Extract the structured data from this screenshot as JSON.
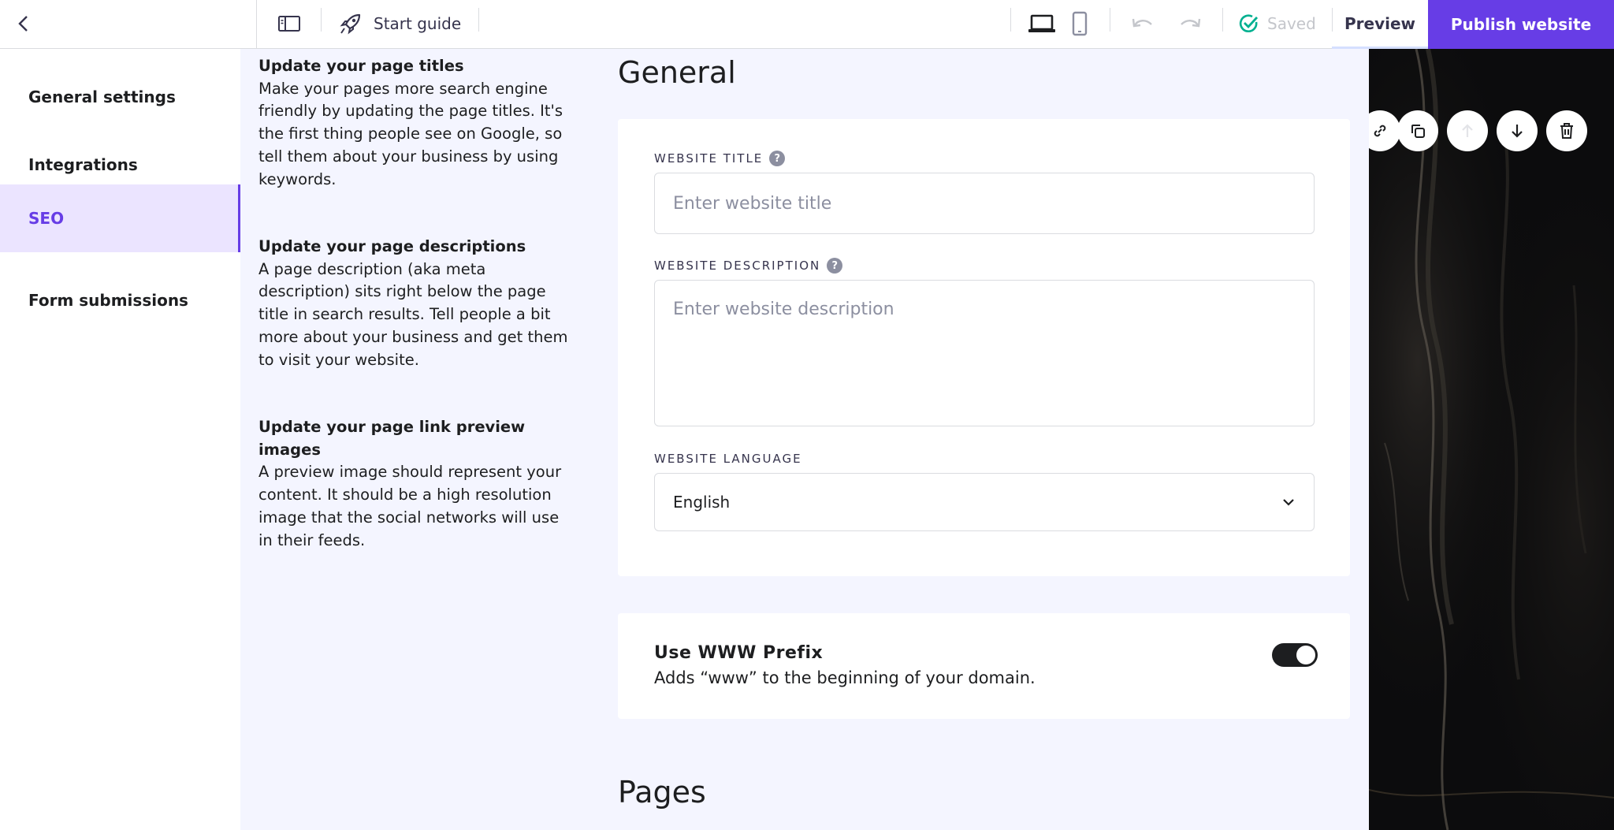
{
  "topbar": {
    "start_guide_label": "Start guide",
    "saved_label": "Saved",
    "preview_label": "Preview",
    "publish_label": "Publish website"
  },
  "sidenav": {
    "items": [
      {
        "label": "General settings",
        "active": false
      },
      {
        "label": "Integrations",
        "active": false
      },
      {
        "label": "SEO",
        "active": true
      },
      {
        "label": "Form submissions",
        "active": false
      }
    ]
  },
  "help": [
    {
      "title": "Update your page titles",
      "body": "Make your pages more search engine friendly by updating the page titles. It's the first thing people see on Google, so tell them about your business by using keywords."
    },
    {
      "title": "Update your page descriptions",
      "body": "A page description (aka meta description) sits right below the page title in search results. Tell people a bit more about your business and get them to visit your website."
    },
    {
      "title": "Update your page link preview images",
      "body": "A preview image should represent your content. It should be a high resolution image that the social networks will use in their feeds."
    }
  ],
  "general": {
    "title": "General",
    "website_title_label": "WEBSITE TITLE",
    "website_title_placeholder": "Enter website title",
    "website_title_value": "",
    "website_description_label": "WEBSITE DESCRIPTION",
    "website_description_placeholder": "Enter website description",
    "website_description_value": "",
    "website_language_label": "WEBSITE LANGUAGE",
    "website_language_value": "English"
  },
  "www_prefix": {
    "title": "Use WWW Prefix",
    "description": "Adds “www” to the beginning of your domain.",
    "enabled": true
  },
  "pages": {
    "title": "Pages"
  },
  "colors": {
    "accent": "#673de6",
    "active_nav_bg": "#ebe4ff",
    "saved_check": "#00b090",
    "main_bg": "#f4f5ff"
  },
  "icons": {
    "back": "chevron-left-icon",
    "sidebar": "sidebar-panel-icon",
    "start_guide": "rocket-icon",
    "desktop": "laptop-icon",
    "mobile": "mobile-icon",
    "undo": "undo-icon",
    "redo": "redo-icon",
    "saved": "check-circle-icon",
    "help": "question-icon",
    "select": "chevron-down-icon",
    "preview_tools": [
      "link-icon",
      "duplicate-icon",
      "arrow-up-icon",
      "arrow-down-icon",
      "trash-icon"
    ]
  }
}
